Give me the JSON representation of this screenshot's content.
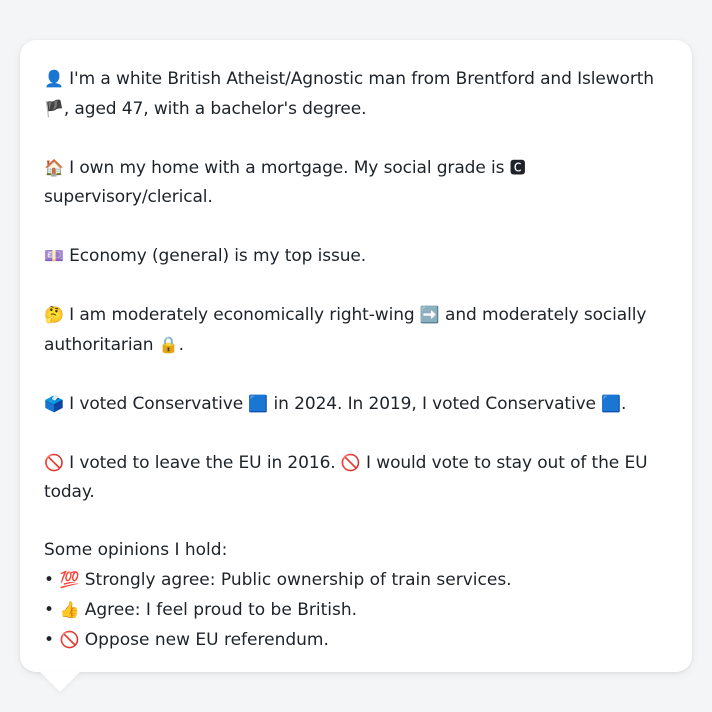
{
  "profile": {
    "identity": {
      "emoji_person": "👤",
      "text": "I'm a white British Atheist/Agnostic man from Brentford and Isleworth",
      "emoji_flag": "🏴",
      "text_end": ", aged 47, with a bachelor's degree."
    },
    "home": {
      "emoji": "🏠",
      "text": "I own my home with a mortgage. My social grade is",
      "grade_icon": "🅲",
      "grade_text": "supervisory/clerical."
    },
    "issue": {
      "emoji": "💷",
      "text": "Economy (general) is my top issue."
    },
    "ideology": {
      "emoji": "🤔",
      "text_1": "I am moderately economically right-wing",
      "emoji_right": "➡️",
      "text_2": "and moderately socially authoritarian",
      "emoji_lock": "🔒",
      "text_end": "."
    },
    "vote": {
      "emoji": "🗳️",
      "text_1": "I voted Conservative",
      "emoji_party_1": "🟦",
      "text_2": "in 2024. In 2019, I voted Conservative",
      "emoji_party_2": "🟦",
      "text_end": "."
    },
    "eu": {
      "emoji_1": "🚫",
      "text_1": "I voted to leave the EU in 2016.",
      "emoji_2": "🚫",
      "text_2": "I would vote to stay out of the EU today."
    }
  },
  "opinions": {
    "title": "Some opinions I hold:",
    "items": [
      {
        "bullet": "•",
        "emoji": "💯",
        "text": "Strongly agree: Public ownership of train services."
      },
      {
        "bullet": "•",
        "emoji": "👍",
        "text": "Agree: I feel proud to be British."
      },
      {
        "bullet": "•",
        "emoji": "🚫",
        "text": "Oppose new EU referendum."
      }
    ]
  },
  "colors": {
    "background": "#f4f5f6",
    "card": "#ffffff",
    "text": "#1d2329"
  }
}
